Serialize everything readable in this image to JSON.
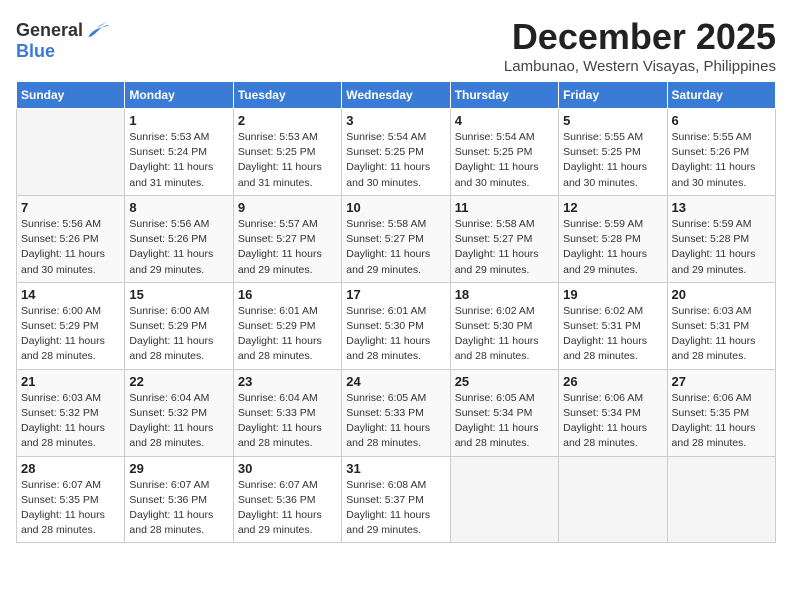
{
  "logo": {
    "general": "General",
    "blue": "Blue"
  },
  "title": "December 2025",
  "location": "Lambunao, Western Visayas, Philippines",
  "headers": [
    "Sunday",
    "Monday",
    "Tuesday",
    "Wednesday",
    "Thursday",
    "Friday",
    "Saturday"
  ],
  "weeks": [
    [
      {
        "day": "",
        "info": ""
      },
      {
        "day": "1",
        "info": "Sunrise: 5:53 AM\nSunset: 5:24 PM\nDaylight: 11 hours\nand 31 minutes."
      },
      {
        "day": "2",
        "info": "Sunrise: 5:53 AM\nSunset: 5:25 PM\nDaylight: 11 hours\nand 31 minutes."
      },
      {
        "day": "3",
        "info": "Sunrise: 5:54 AM\nSunset: 5:25 PM\nDaylight: 11 hours\nand 30 minutes."
      },
      {
        "day": "4",
        "info": "Sunrise: 5:54 AM\nSunset: 5:25 PM\nDaylight: 11 hours\nand 30 minutes."
      },
      {
        "day": "5",
        "info": "Sunrise: 5:55 AM\nSunset: 5:25 PM\nDaylight: 11 hours\nand 30 minutes."
      },
      {
        "day": "6",
        "info": "Sunrise: 5:55 AM\nSunset: 5:26 PM\nDaylight: 11 hours\nand 30 minutes."
      }
    ],
    [
      {
        "day": "7",
        "info": "Sunrise: 5:56 AM\nSunset: 5:26 PM\nDaylight: 11 hours\nand 30 minutes."
      },
      {
        "day": "8",
        "info": "Sunrise: 5:56 AM\nSunset: 5:26 PM\nDaylight: 11 hours\nand 29 minutes."
      },
      {
        "day": "9",
        "info": "Sunrise: 5:57 AM\nSunset: 5:27 PM\nDaylight: 11 hours\nand 29 minutes."
      },
      {
        "day": "10",
        "info": "Sunrise: 5:58 AM\nSunset: 5:27 PM\nDaylight: 11 hours\nand 29 minutes."
      },
      {
        "day": "11",
        "info": "Sunrise: 5:58 AM\nSunset: 5:27 PM\nDaylight: 11 hours\nand 29 minutes."
      },
      {
        "day": "12",
        "info": "Sunrise: 5:59 AM\nSunset: 5:28 PM\nDaylight: 11 hours\nand 29 minutes."
      },
      {
        "day": "13",
        "info": "Sunrise: 5:59 AM\nSunset: 5:28 PM\nDaylight: 11 hours\nand 29 minutes."
      }
    ],
    [
      {
        "day": "14",
        "info": "Sunrise: 6:00 AM\nSunset: 5:29 PM\nDaylight: 11 hours\nand 28 minutes."
      },
      {
        "day": "15",
        "info": "Sunrise: 6:00 AM\nSunset: 5:29 PM\nDaylight: 11 hours\nand 28 minutes."
      },
      {
        "day": "16",
        "info": "Sunrise: 6:01 AM\nSunset: 5:29 PM\nDaylight: 11 hours\nand 28 minutes."
      },
      {
        "day": "17",
        "info": "Sunrise: 6:01 AM\nSunset: 5:30 PM\nDaylight: 11 hours\nand 28 minutes."
      },
      {
        "day": "18",
        "info": "Sunrise: 6:02 AM\nSunset: 5:30 PM\nDaylight: 11 hours\nand 28 minutes."
      },
      {
        "day": "19",
        "info": "Sunrise: 6:02 AM\nSunset: 5:31 PM\nDaylight: 11 hours\nand 28 minutes."
      },
      {
        "day": "20",
        "info": "Sunrise: 6:03 AM\nSunset: 5:31 PM\nDaylight: 11 hours\nand 28 minutes."
      }
    ],
    [
      {
        "day": "21",
        "info": "Sunrise: 6:03 AM\nSunset: 5:32 PM\nDaylight: 11 hours\nand 28 minutes."
      },
      {
        "day": "22",
        "info": "Sunrise: 6:04 AM\nSunset: 5:32 PM\nDaylight: 11 hours\nand 28 minutes."
      },
      {
        "day": "23",
        "info": "Sunrise: 6:04 AM\nSunset: 5:33 PM\nDaylight: 11 hours\nand 28 minutes."
      },
      {
        "day": "24",
        "info": "Sunrise: 6:05 AM\nSunset: 5:33 PM\nDaylight: 11 hours\nand 28 minutes."
      },
      {
        "day": "25",
        "info": "Sunrise: 6:05 AM\nSunset: 5:34 PM\nDaylight: 11 hours\nand 28 minutes."
      },
      {
        "day": "26",
        "info": "Sunrise: 6:06 AM\nSunset: 5:34 PM\nDaylight: 11 hours\nand 28 minutes."
      },
      {
        "day": "27",
        "info": "Sunrise: 6:06 AM\nSunset: 5:35 PM\nDaylight: 11 hours\nand 28 minutes."
      }
    ],
    [
      {
        "day": "28",
        "info": "Sunrise: 6:07 AM\nSunset: 5:35 PM\nDaylight: 11 hours\nand 28 minutes."
      },
      {
        "day": "29",
        "info": "Sunrise: 6:07 AM\nSunset: 5:36 PM\nDaylight: 11 hours\nand 28 minutes."
      },
      {
        "day": "30",
        "info": "Sunrise: 6:07 AM\nSunset: 5:36 PM\nDaylight: 11 hours\nand 29 minutes."
      },
      {
        "day": "31",
        "info": "Sunrise: 6:08 AM\nSunset: 5:37 PM\nDaylight: 11 hours\nand 29 minutes."
      },
      {
        "day": "",
        "info": ""
      },
      {
        "day": "",
        "info": ""
      },
      {
        "day": "",
        "info": ""
      }
    ]
  ]
}
